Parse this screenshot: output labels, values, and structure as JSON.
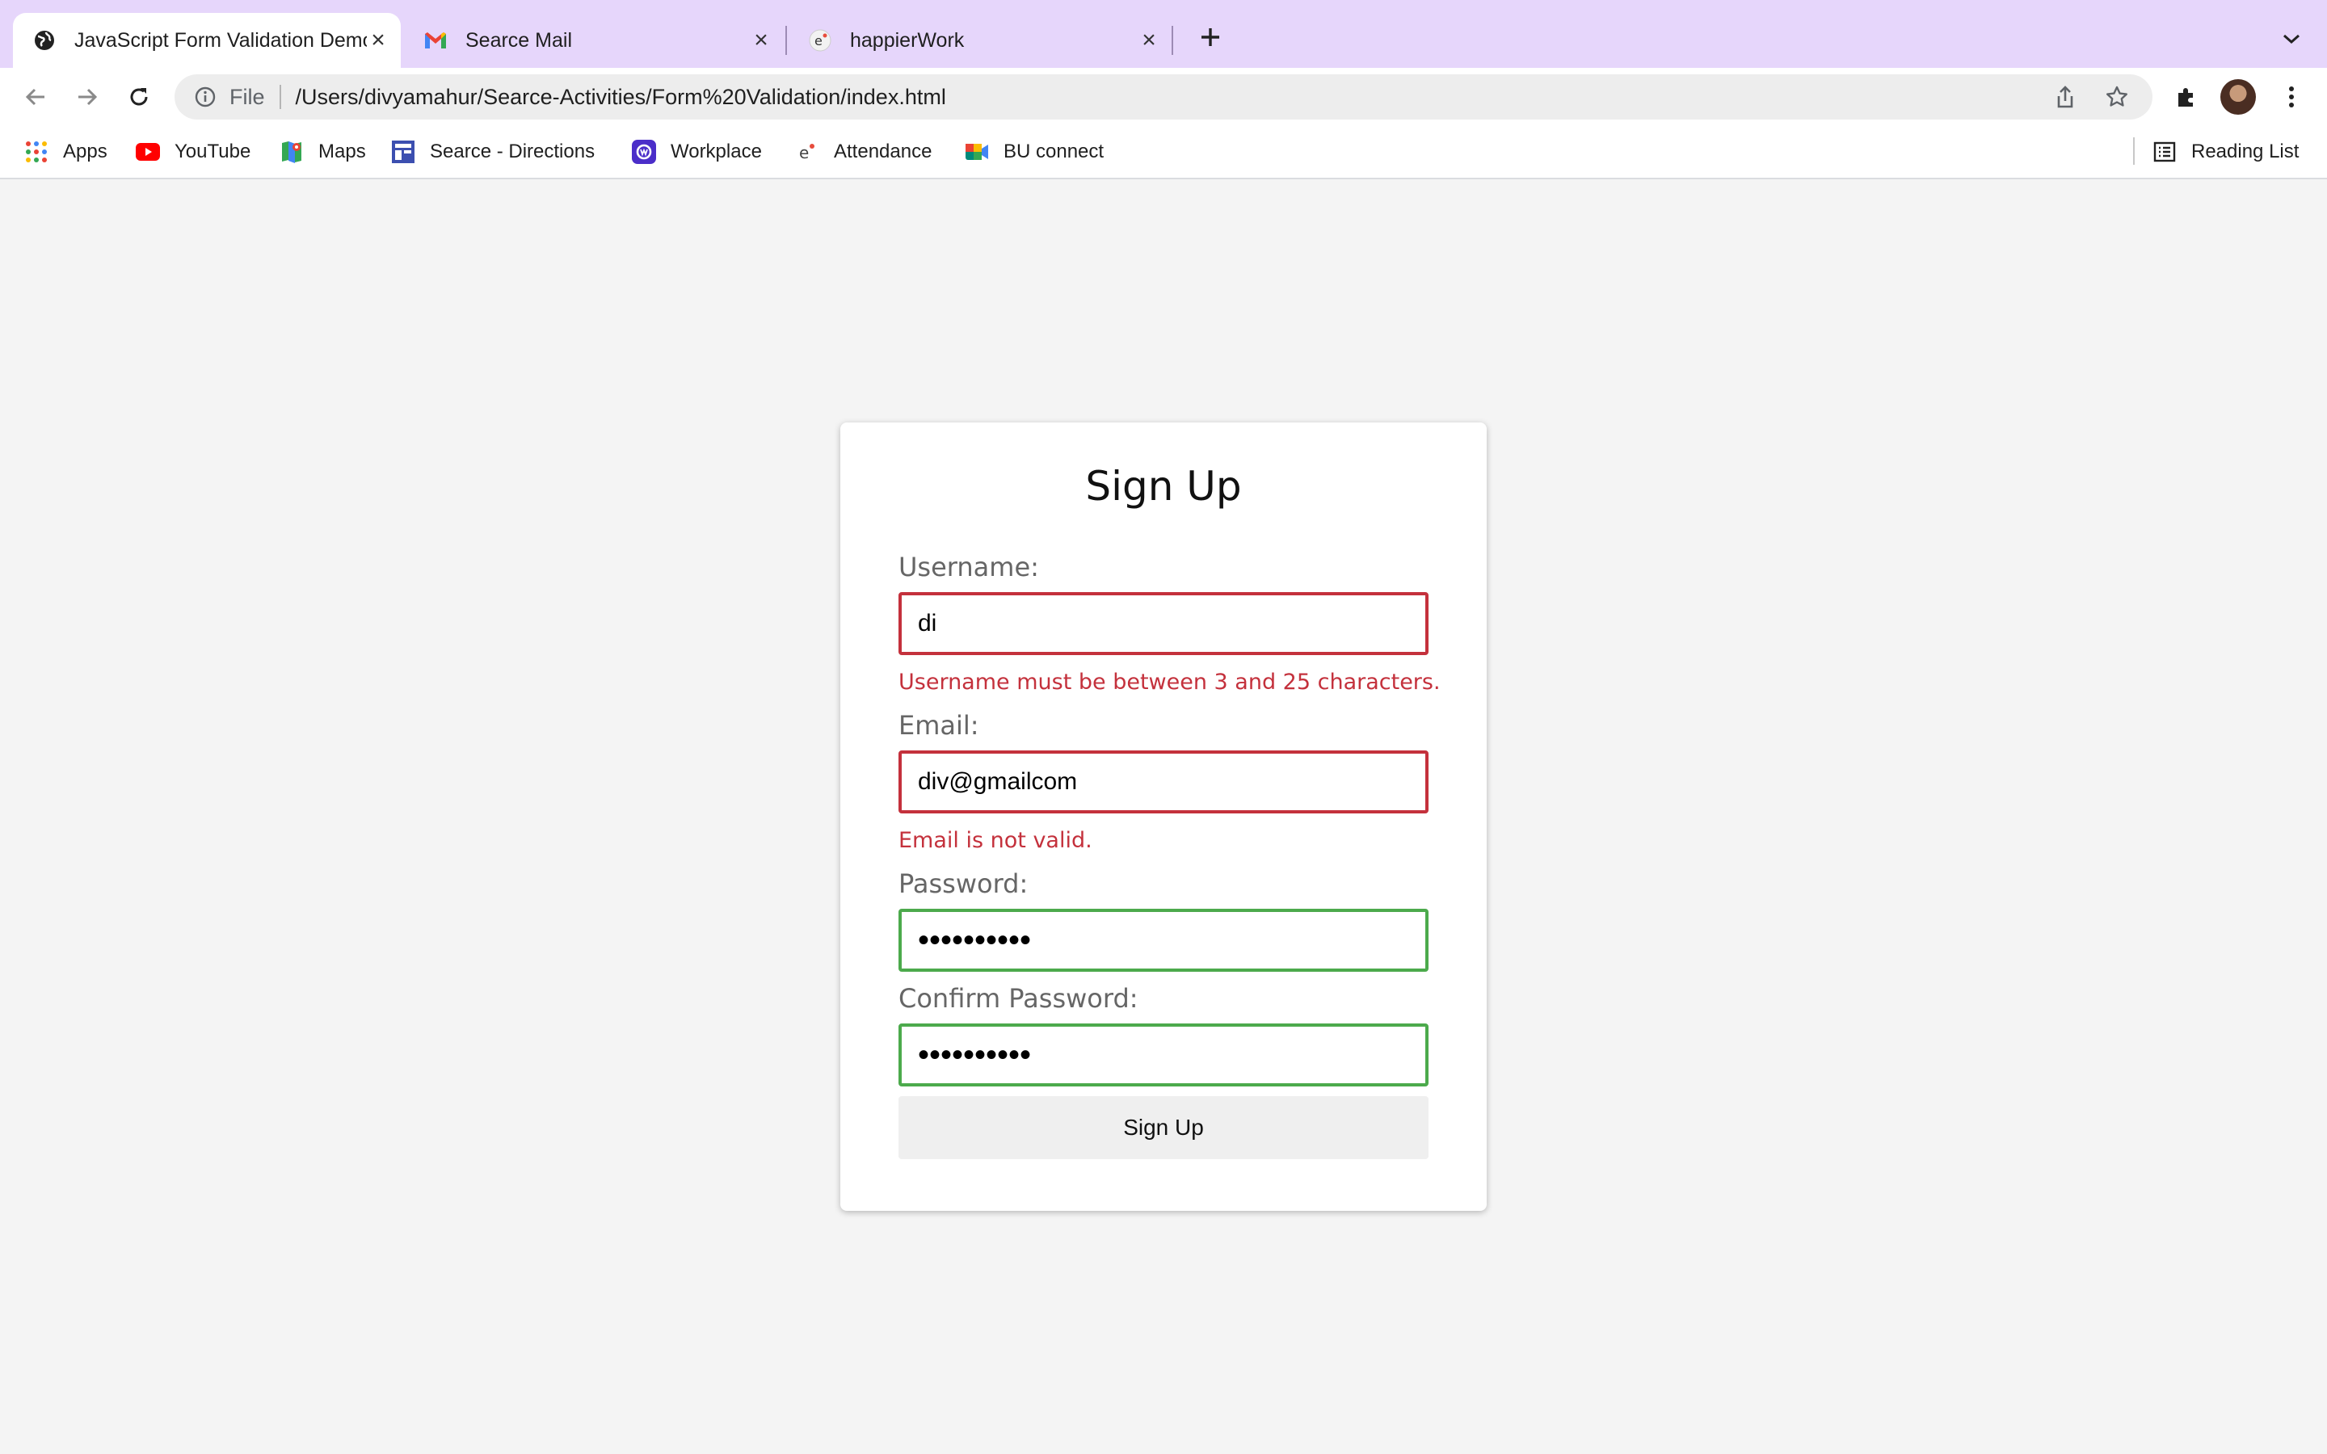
{
  "tabs": [
    {
      "title": "JavaScript Form Validation Demo",
      "icon": "globe-icon"
    },
    {
      "title": "Searce Mail",
      "icon": "gmail-icon"
    },
    {
      "title": "happierWork",
      "icon": "happierwork-icon"
    }
  ],
  "address_bar": {
    "scheme": "File",
    "url": "/Users/divyamahur/Searce-Activities/Form%20Validation/index.html"
  },
  "bookmarks": [
    {
      "label": "Apps",
      "icon": "apps-grid-icon"
    },
    {
      "label": "YouTube",
      "icon": "youtube-icon"
    },
    {
      "label": "Maps",
      "icon": "maps-icon"
    },
    {
      "label": "Searce - Directions",
      "icon": "directions-icon"
    },
    {
      "label": "Workplace",
      "icon": "workplace-icon"
    },
    {
      "label": "Attendance",
      "icon": "attendance-icon"
    },
    {
      "label": "BU connect",
      "icon": "meet-icon"
    }
  ],
  "reading_list": "Reading List",
  "form": {
    "title": "Sign Up",
    "username_label": "Username:",
    "username_value": "di",
    "username_error": "Username must be between 3 and 25 characters.",
    "email_label": "Email:",
    "email_value": "div@gmailcom",
    "email_error": "Email is not valid.",
    "password_label": "Password:",
    "password_value": "••••••••••",
    "confirm_label": "Confirm Password:",
    "confirm_value": "••••••••••",
    "submit_label": "Sign Up"
  },
  "colors": {
    "tabstrip": "#e6d6fb",
    "error": "#c4313c",
    "success": "#4caa4c"
  }
}
